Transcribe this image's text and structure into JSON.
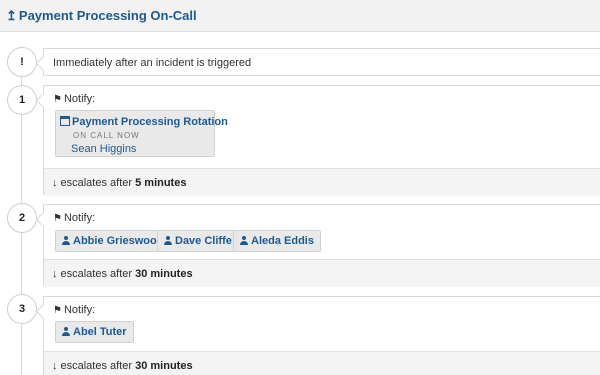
{
  "header": {
    "icon": "up-arrow-icon",
    "title": "Payment Processing On-Call"
  },
  "trigger": {
    "marker": "!",
    "text": "Immediately after an incident is triggered"
  },
  "steps": [
    {
      "number": "1",
      "notify_label": "Notify:",
      "rotation": {
        "name": "Payment Processing Rotation",
        "status": "ON CALL NOW",
        "person": "Sean Higgins"
      },
      "escalate_prefix": "escalates after",
      "escalate_value": "5 minutes"
    },
    {
      "number": "2",
      "notify_label": "Notify:",
      "users": [
        "Abbie Grieswood",
        "Dave Cliffe",
        "Aleda Eddis"
      ],
      "escalate_prefix": "escalates after",
      "escalate_value": "30 minutes"
    },
    {
      "number": "3",
      "notify_label": "Notify:",
      "users": [
        "Abel Tuter"
      ],
      "escalate_prefix": "escalates after",
      "escalate_value": "30 minutes"
    }
  ]
}
